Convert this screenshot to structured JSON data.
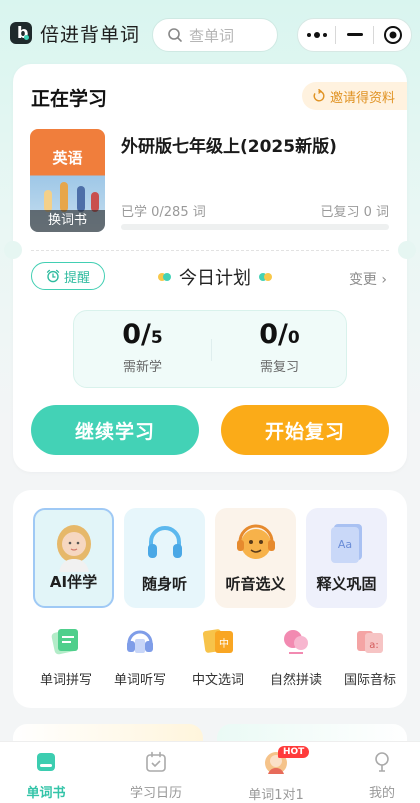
{
  "app": {
    "name": "倍进背单词",
    "logo_letter": "b"
  },
  "search": {
    "placeholder": "查单词"
  },
  "studying": {
    "title": "正在学习",
    "invite_label": "邀请得资料",
    "book": {
      "cover_subject": "英语",
      "change_label": "换词书",
      "title": "外研版七年级上(2025新版)"
    },
    "learned_text": "已学 0/285 词",
    "reviewed_text": "已复习 0 词",
    "progress_fraction": 0
  },
  "plan": {
    "remind_label": "提醒",
    "title": "今日计划",
    "change_label": "变更 ›",
    "new_count": "0/",
    "new_target": "5",
    "new_label": "需新学",
    "review_count": "0/",
    "review_target": "0",
    "review_label": "需复习"
  },
  "actions": {
    "continue_label": "继续学习",
    "review_label": "开始复习"
  },
  "features": [
    {
      "label": "AI伴学",
      "icon": "ai-tutor-avatar-icon"
    },
    {
      "label": "随身听",
      "icon": "headphones-icon"
    },
    {
      "label": "听音选义",
      "icon": "listening-face-icon"
    },
    {
      "label": "释义巩固",
      "icon": "definition-book-icon"
    }
  ],
  "tools": [
    {
      "label": "单词拼写",
      "icon": "spelling-icon"
    },
    {
      "label": "单词听写",
      "icon": "dictation-icon"
    },
    {
      "label": "中文选词",
      "icon": "chinese-choice-icon"
    },
    {
      "label": "自然拼读",
      "icon": "phonics-icon"
    },
    {
      "label": "国际音标",
      "icon": "phonetic-symbol-icon"
    }
  ],
  "tabs": [
    {
      "label": "单词书",
      "active": true
    },
    {
      "label": "学习日历",
      "active": false
    },
    {
      "label": "单词1对1",
      "active": false,
      "badge": "HOT"
    },
    {
      "label": "我的",
      "active": false
    }
  ],
  "colors": {
    "accent": "#43d2b6",
    "orange": "#fbab18",
    "invite": "#e09324"
  }
}
